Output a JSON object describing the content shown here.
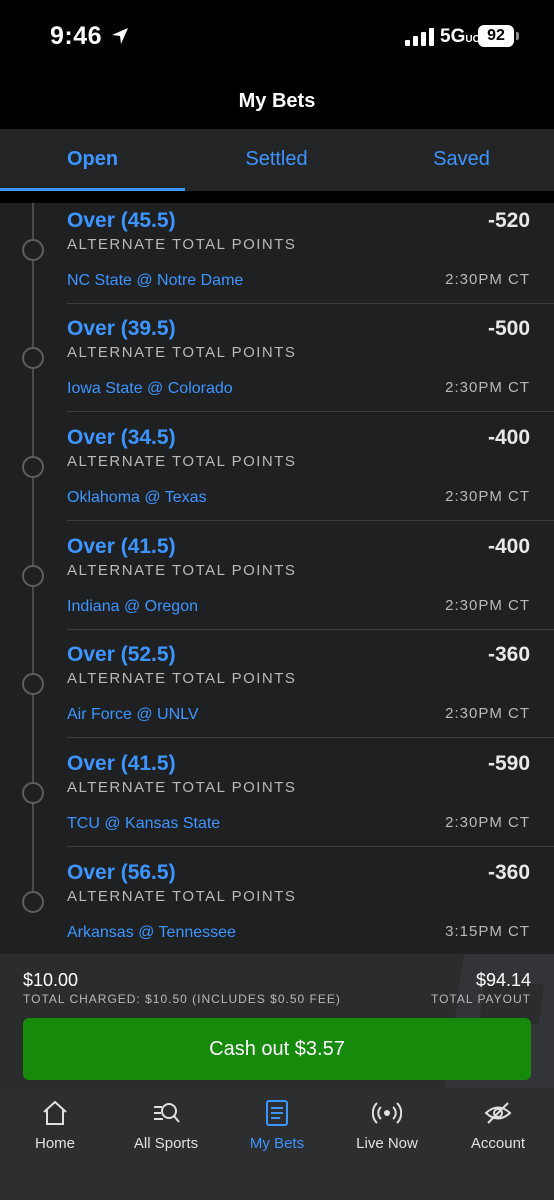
{
  "status_bar": {
    "time": "9:46",
    "network": "5G",
    "network_sub": "UC",
    "battery": "92"
  },
  "header": {
    "title": "My Bets"
  },
  "tabs": [
    {
      "label": "Open",
      "active": true
    },
    {
      "label": "Settled",
      "active": false
    },
    {
      "label": "Saved",
      "active": false
    }
  ],
  "bets": [
    {
      "pick": "Over (45.5)",
      "odds": "-520",
      "market": "ALTERNATE TOTAL POINTS",
      "game": "NC State @ Notre Dame",
      "time": "2:30PM CT"
    },
    {
      "pick": "Over (39.5)",
      "odds": "-500",
      "market": "ALTERNATE TOTAL POINTS",
      "game": "Iowa State @ Colorado",
      "time": "2:30PM CT"
    },
    {
      "pick": "Over (34.5)",
      "odds": "-400",
      "market": "ALTERNATE TOTAL POINTS",
      "game": "Oklahoma @ Texas",
      "time": "2:30PM CT"
    },
    {
      "pick": "Over (41.5)",
      "odds": "-400",
      "market": "ALTERNATE TOTAL POINTS",
      "game": "Indiana @ Oregon",
      "time": "2:30PM CT"
    },
    {
      "pick": "Over (52.5)",
      "odds": "-360",
      "market": "ALTERNATE TOTAL POINTS",
      "game": "Air Force @ UNLV",
      "time": "2:30PM CT"
    },
    {
      "pick": "Over (41.5)",
      "odds": "-590",
      "market": "ALTERNATE TOTAL POINTS",
      "game": "TCU @ Kansas State",
      "time": "2:30PM CT"
    },
    {
      "pick": "Over (56.5)",
      "odds": "-360",
      "market": "ALTERNATE TOTAL POINTS",
      "game": "Arkansas @ Tennessee",
      "time": "3:15PM CT"
    }
  ],
  "summary": {
    "stake": "$10.00",
    "total_charged": "TOTAL CHARGED: $10.50 (INCLUDES $0.50 FEE)",
    "payout": "$94.14",
    "payout_label": "TOTAL PAYOUT",
    "cashout_label": "Cash out $3.57"
  },
  "bottom_nav": [
    {
      "label": "Home",
      "icon": "home-icon"
    },
    {
      "label": "All Sports",
      "icon": "all-sports-icon"
    },
    {
      "label": "My Bets",
      "icon": "my-bets-icon",
      "active": true
    },
    {
      "label": "Live Now",
      "icon": "live-now-icon"
    },
    {
      "label": "Account",
      "icon": "account-icon"
    }
  ],
  "colors": {
    "accent": "#3d95ff",
    "cashout": "#158a0b",
    "list_bg": "#1f2022"
  }
}
